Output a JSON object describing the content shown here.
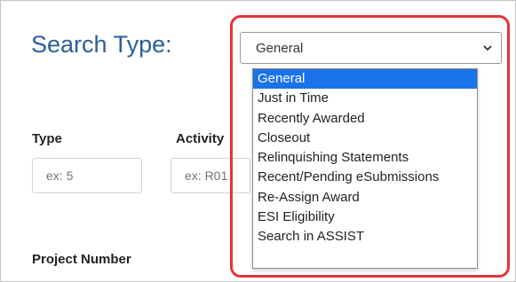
{
  "search_type": {
    "label": "Search Type:",
    "selected": "General",
    "options": [
      "General",
      "Just in Time",
      "Recently Awarded",
      "Closeout",
      "Relinquishing Statements",
      "Recent/Pending eSubmissions",
      "Re-Assign Award",
      "ESI Eligibility",
      "Search in ASSIST"
    ]
  },
  "fields": {
    "type_label": "Type",
    "type_placeholder": "ex: 5",
    "activity_label": "Activity",
    "activity_placeholder": "ex: R01",
    "project_number_label": "Project Number"
  },
  "colors": {
    "accent": "#2c5e98",
    "selected_option": "#1a73e8",
    "callout": "#e3343a"
  }
}
